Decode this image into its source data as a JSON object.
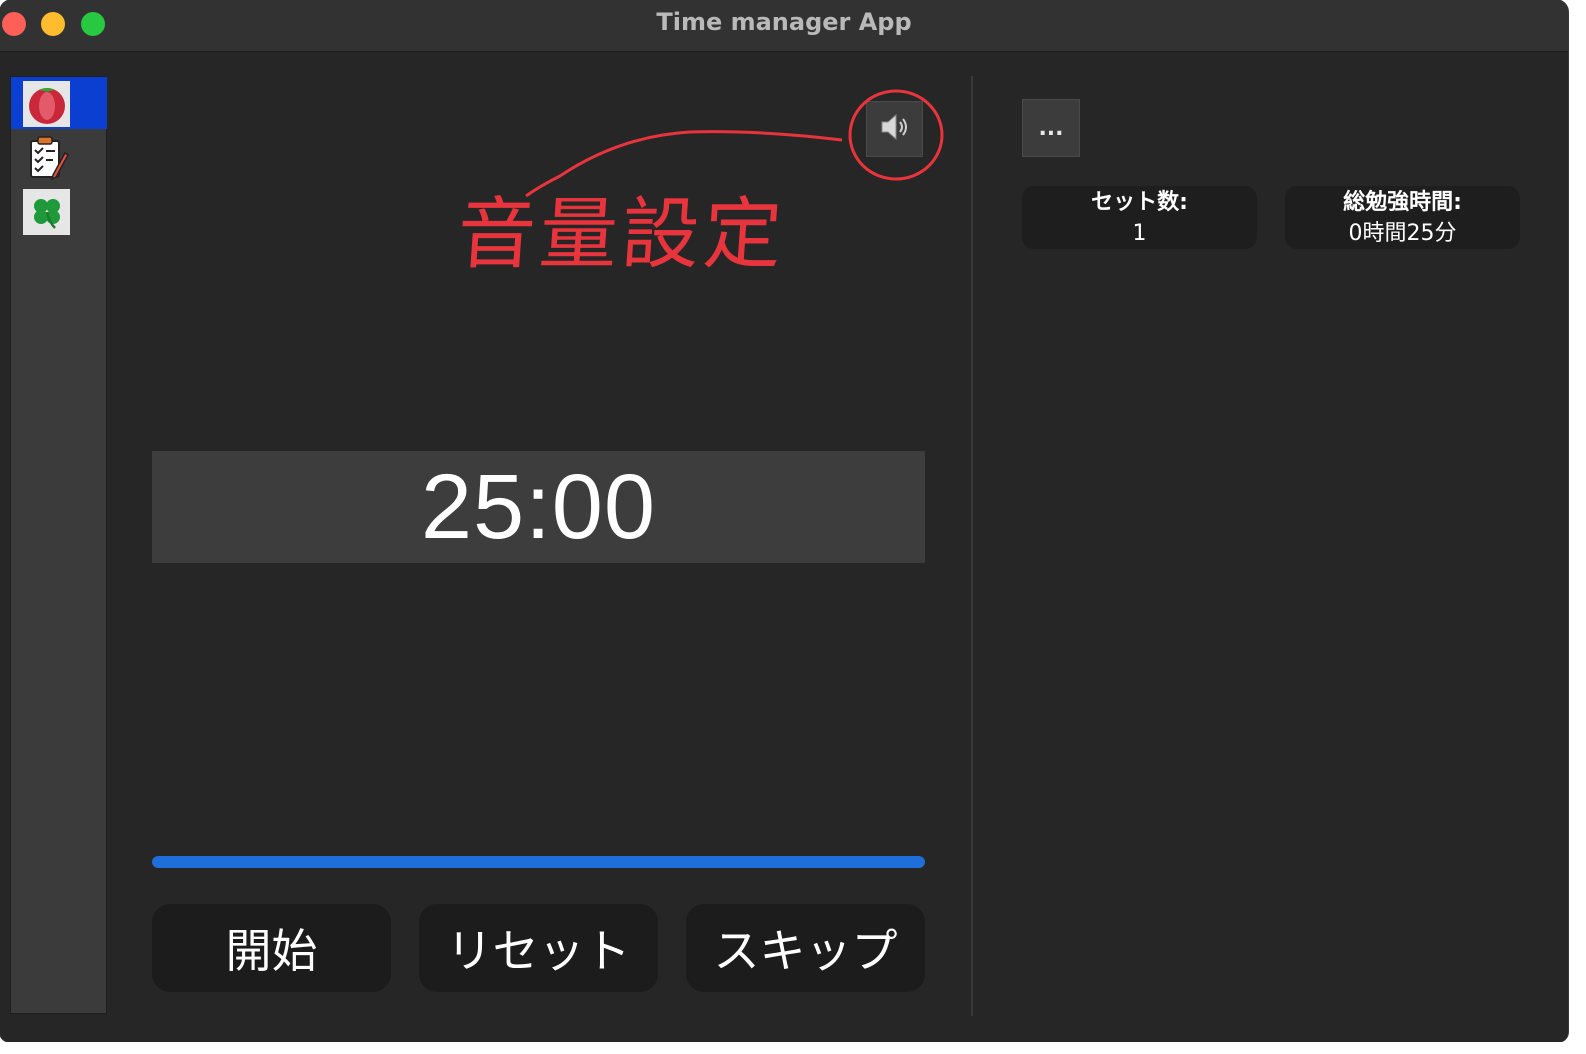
{
  "window": {
    "title": "Time manager App"
  },
  "sidebar": {
    "items": [
      {
        "icon": "tomato-icon",
        "active": true
      },
      {
        "icon": "clipboard-checklist-icon",
        "active": false
      },
      {
        "icon": "clover-icon",
        "active": false
      }
    ]
  },
  "main": {
    "sound_button_icon": "speaker-icon",
    "annotation_text": "音量設定",
    "timer": "25:00",
    "progress": 1.0,
    "buttons": {
      "start": "開始",
      "reset": "リセット",
      "skip": "スキップ"
    }
  },
  "right_panel": {
    "more_label": "...",
    "stats": [
      {
        "label": "セット数:",
        "value": "1"
      },
      {
        "label": "総勉強時間:",
        "value": "0時間25分"
      }
    ]
  },
  "colors": {
    "accent": "#1e6fd9",
    "sidebar_active": "#0a3fd1",
    "annotation": "#e8343c"
  }
}
